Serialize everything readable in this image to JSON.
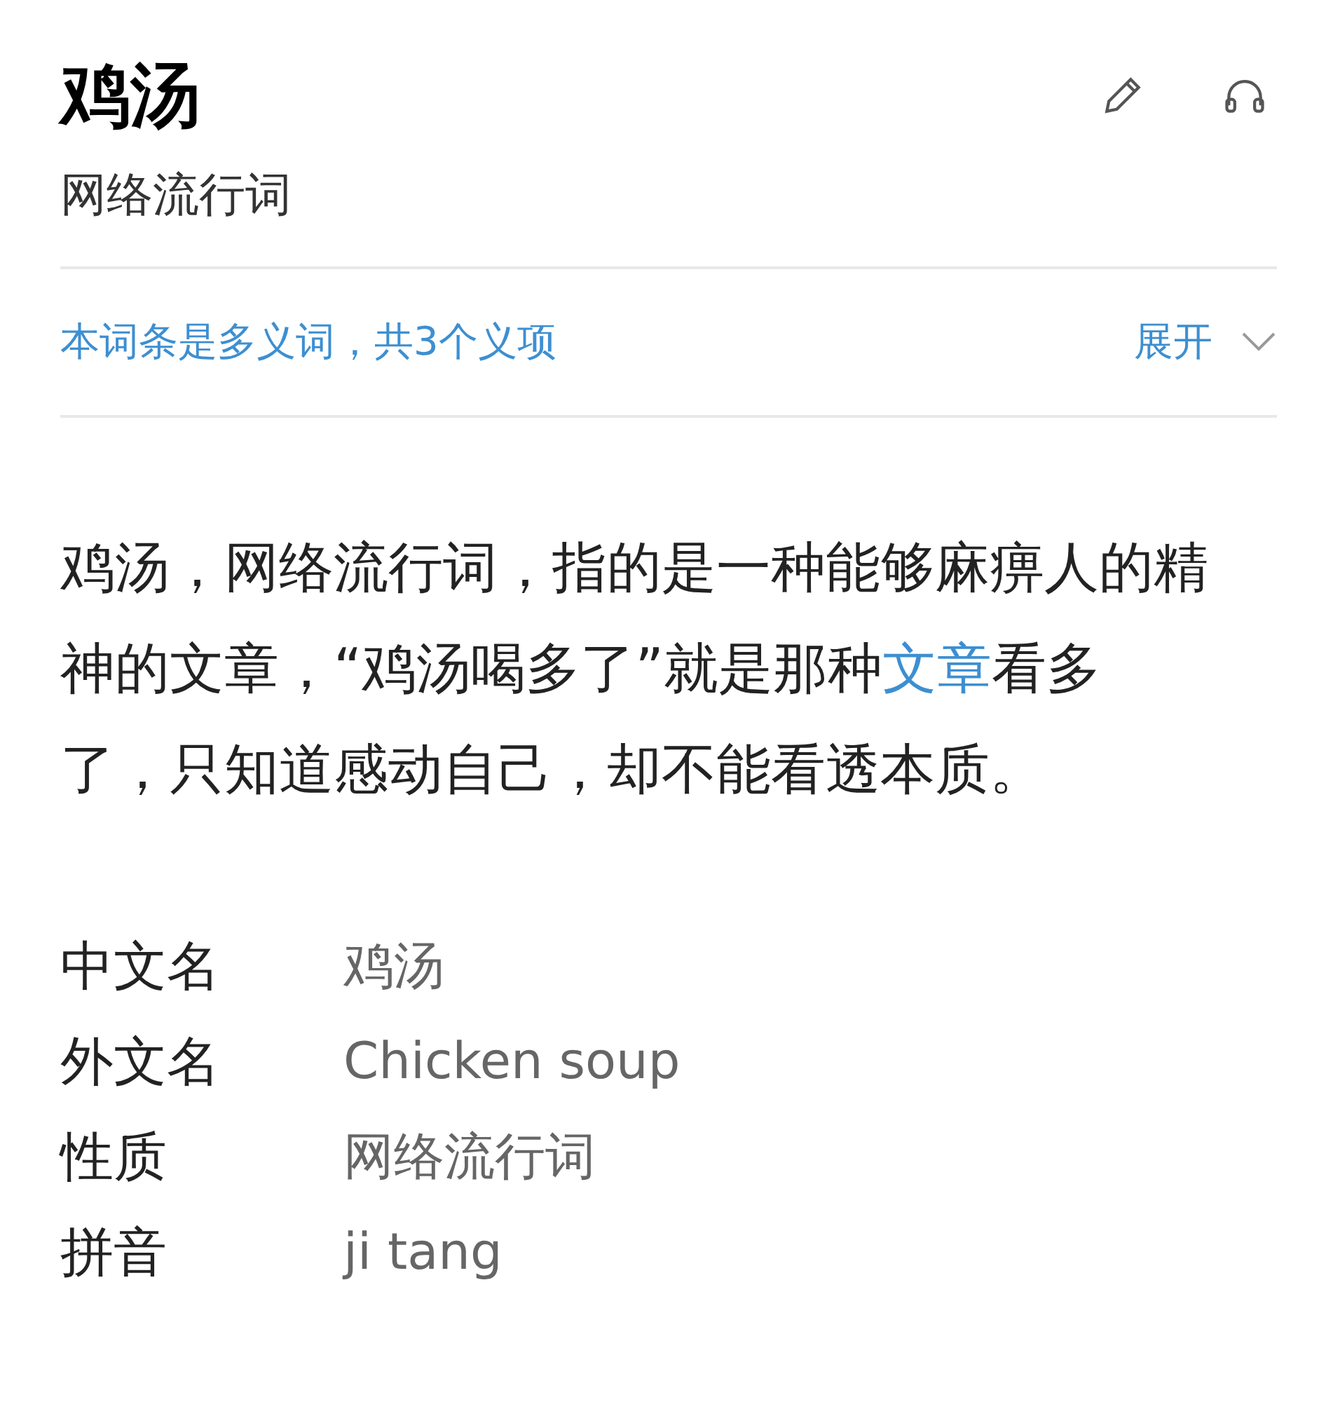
{
  "title": "鸡汤",
  "subtitle": "网络流行词",
  "notice": {
    "text": "本词条是多义词，共3个义项",
    "toggle": "展开",
    "expanded": false
  },
  "summary": {
    "before": "鸡汤，网络流行词，指的是一种能够麻痹人的精神的文章，“鸡汤喝多了”就是那种",
    "link": "文章",
    "after": "看多了，只知道感动自己，却不能看透本质。"
  },
  "info": [
    {
      "label": "中文名",
      "value": "鸡汤"
    },
    {
      "label": "外文名",
      "value": "Chicken soup"
    },
    {
      "label": "性质",
      "value": "网络流行词"
    },
    {
      "label": "拼音",
      "value": "ji tang"
    }
  ]
}
